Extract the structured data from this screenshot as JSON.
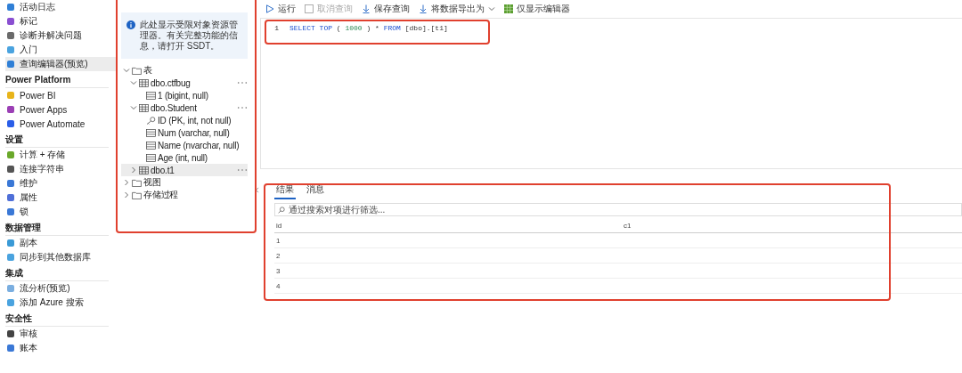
{
  "sidebar": {
    "sections": [
      {
        "items": [
          {
            "label": "活动日志",
            "selected": false
          },
          {
            "label": "标记",
            "selected": false
          },
          {
            "label": "诊断并解决问题",
            "selected": false
          },
          {
            "label": "入门",
            "selected": false
          },
          {
            "label": "查询编辑器(预览)",
            "selected": true
          }
        ]
      },
      {
        "header": "Power Platform",
        "items": [
          {
            "label": "Power BI",
            "selected": false
          },
          {
            "label": "Power Apps",
            "selected": false
          },
          {
            "label": "Power Automate",
            "selected": false
          }
        ]
      },
      {
        "header": "设置",
        "items": [
          {
            "label": "计算 + 存储",
            "selected": false
          },
          {
            "label": "连接字符串",
            "selected": false
          },
          {
            "label": "维护",
            "selected": false
          },
          {
            "label": "属性",
            "selected": false
          },
          {
            "label": "锁",
            "selected": false
          }
        ]
      },
      {
        "header": "数据管理",
        "items": [
          {
            "label": "副本",
            "selected": false
          },
          {
            "label": "同步到其他数据库",
            "selected": false
          }
        ]
      },
      {
        "header": "集成",
        "items": [
          {
            "label": "流分析(预览)",
            "selected": false
          },
          {
            "label": "添加 Azure 搜索",
            "selected": false
          }
        ]
      },
      {
        "header": "安全性",
        "items": [
          {
            "label": "审核",
            "selected": false
          },
          {
            "label": "账本",
            "selected": false
          }
        ]
      }
    ]
  },
  "explorer": {
    "info": "此处显示受限对象资源管理器。有关完整功能的信息，请打开 SSDT。",
    "tree": [
      {
        "label": "表",
        "kind": "folder",
        "expanded": true,
        "selected": false,
        "children": [
          {
            "label": "dbo.ctfbug",
            "kind": "table",
            "expanded": true,
            "selected": false,
            "children": [
              {
                "label": "1 (bigint, null)",
                "kind": "column",
                "selected": false
              }
            ]
          },
          {
            "label": "dbo.Student",
            "kind": "table",
            "expanded": true,
            "selected": false,
            "children": [
              {
                "label": "ID (PK, int, not null)",
                "kind": "key",
                "selected": false
              },
              {
                "label": "Num (varchar, null)",
                "kind": "column",
                "selected": false
              },
              {
                "label": "Name (nvarchar, null)",
                "kind": "column",
                "selected": false
              },
              {
                "label": "Age (int, null)",
                "kind": "column",
                "selected": false
              }
            ]
          },
          {
            "label": "dbo.t1",
            "kind": "table",
            "expanded": false,
            "selected": true
          }
        ]
      },
      {
        "label": "视图",
        "kind": "folder",
        "expanded": false,
        "selected": false
      },
      {
        "label": "存储过程",
        "kind": "folder",
        "expanded": false,
        "selected": false
      }
    ]
  },
  "toolbar": [
    {
      "label": "运行",
      "kind": "run",
      "disabled": false
    },
    {
      "label": "取消查询",
      "kind": "cancel",
      "disabled": true
    },
    {
      "label": "保存查询",
      "kind": "save",
      "disabled": false
    },
    {
      "label": "将数据导出为",
      "kind": "export",
      "disabled": false
    },
    {
      "label": "仅显示编辑器",
      "kind": "grid",
      "disabled": false
    }
  ],
  "editor": {
    "lines": [
      {
        "number": "1",
        "tokens": [
          {
            "text": "SELECT TOP",
            "kind": "keyword"
          },
          {
            "text": "(",
            "kind": "plain"
          },
          {
            "text": "1000",
            "kind": "number"
          },
          {
            "text": ")",
            "kind": "plain"
          },
          {
            "text": "*",
            "kind": "plain"
          },
          {
            "text": "FROM",
            "kind": "keyword"
          },
          {
            "text": "[dbo].[t1]",
            "kind": "plain"
          }
        ]
      }
    ]
  },
  "results": {
    "tabs": [
      {
        "label": "结果",
        "selected": true
      },
      {
        "label": "消息",
        "selected": false
      }
    ],
    "filter": {
      "placeholder": "通过搜索对项进行筛选..."
    },
    "columns": [
      "id",
      "c1"
    ],
    "rows": [
      [
        "1",
        ""
      ],
      [
        "2",
        ""
      ],
      [
        "3",
        ""
      ],
      [
        "4",
        ""
      ]
    ]
  }
}
